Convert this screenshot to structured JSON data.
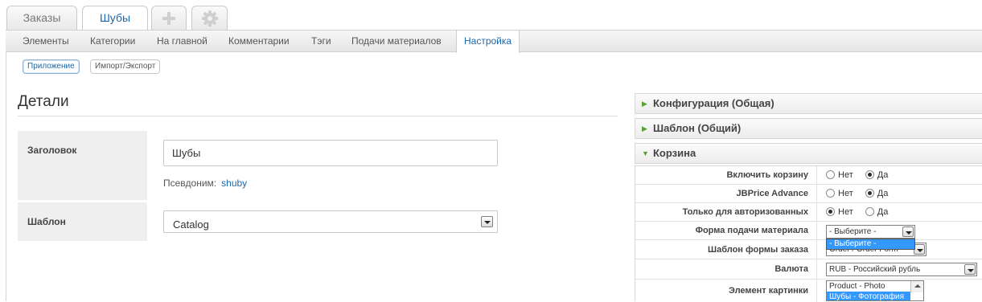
{
  "app_tabs": [
    {
      "label": "Заказы"
    },
    {
      "label": "Шубы"
    }
  ],
  "app_tab_icons": [
    "plus-icon",
    "gear-icon"
  ],
  "subnav": [
    "Элементы",
    "Категории",
    "На главной",
    "Комментарии",
    "Тэги",
    "Подачи материалов",
    "Настройка"
  ],
  "pills": [
    "Приложение",
    "Импорт/Экспорт"
  ],
  "details": {
    "title": "Детали",
    "title_label": "Заголовок",
    "title_value": "Шубы",
    "alias_label": "Псевдоним:",
    "alias_value": "shuby",
    "template_label": "Шаблон",
    "template_value": "Catalog"
  },
  "accordion": {
    "config_header": "Конфигурация (Общая)",
    "template_header": "Шаблон (Общий)",
    "cart_header": "Корзина"
  },
  "cart": {
    "enable_label": "Включить корзину",
    "jbprice_label": "JBPrice Advance",
    "auth_only_label": "Только для авторизованных",
    "no": "Нет",
    "yes": "Да",
    "form_label": "Форма подачи материала",
    "form_value": "- Выберите -",
    "form_dropdown_option": "- Выберите -",
    "order_form_label": "Шаблон формы заказа",
    "order_form_value": "Order / Order Form",
    "currency_label": "Валюта",
    "currency_value": "RUB - Российский рубль",
    "image_label": "Элемент картинки",
    "image_options": [
      "Product - Photo",
      "Шубы - Фотография"
    ]
  }
}
